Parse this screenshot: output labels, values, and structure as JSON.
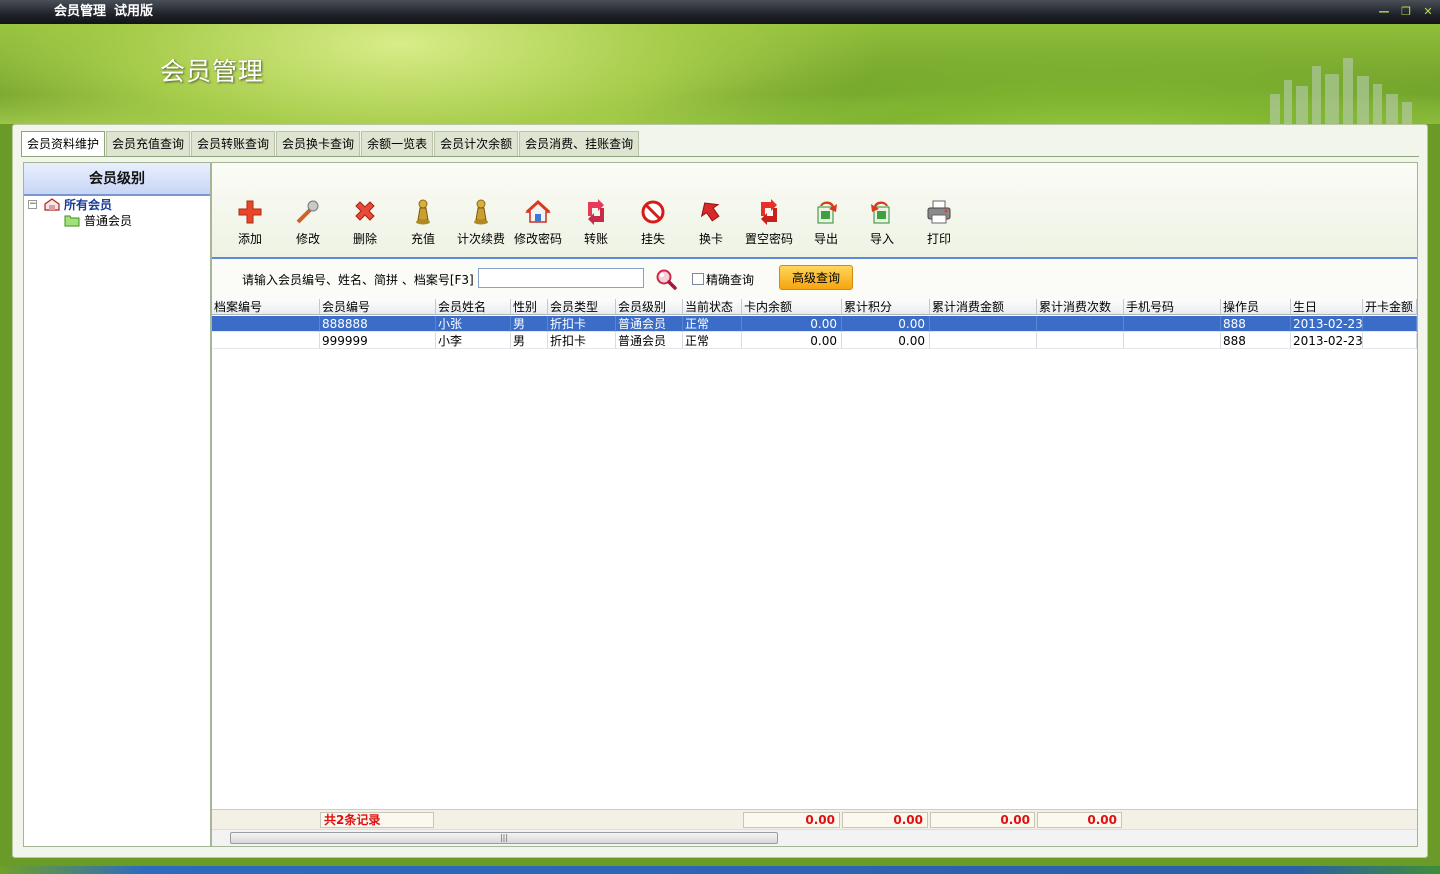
{
  "window": {
    "title": "会员管理",
    "edition": "试用版",
    "controls": [
      "—",
      "❐",
      "✕"
    ]
  },
  "banner": {
    "title": "会员管理"
  },
  "tabs": [
    {
      "label": "会员资料维护",
      "active": true
    },
    {
      "label": "会员充值查询"
    },
    {
      "label": "会员转账查询"
    },
    {
      "label": "会员换卡查询"
    },
    {
      "label": "余额一览表"
    },
    {
      "label": "会员计次余额"
    },
    {
      "label": "会员消费、挂账查询"
    }
  ],
  "sidebar": {
    "title": "会员级别",
    "tree": {
      "root": "所有会员",
      "expander": "−",
      "children": [
        "普通会员"
      ]
    }
  },
  "toolbar": {
    "buttons": [
      {
        "label": "添加",
        "icon": "add-icon"
      },
      {
        "label": "修改",
        "icon": "edit-icon"
      },
      {
        "label": "删除",
        "icon": "delete-icon"
      },
      {
        "label": "充值",
        "icon": "recharge-icon"
      },
      {
        "label": "计次续费",
        "icon": "count-renew-icon"
      },
      {
        "label": "修改密码",
        "icon": "change-password-icon"
      },
      {
        "label": "转账",
        "icon": "transfer-icon"
      },
      {
        "label": "挂失",
        "icon": "report-loss-icon"
      },
      {
        "label": "换卡",
        "icon": "replace-card-icon"
      },
      {
        "label": "置空密码",
        "icon": "clear-password-icon"
      },
      {
        "label": "导出",
        "icon": "export-icon"
      },
      {
        "label": "导入",
        "icon": "import-icon"
      },
      {
        "label": "打印",
        "icon": "print-icon"
      }
    ]
  },
  "search": {
    "label": "请输入会员编号、姓名、简拼 、档案号[F3]",
    "value": "",
    "exact_label": "精确查询",
    "exact_checked": false,
    "advanced_label": "高级查询"
  },
  "grid": {
    "columns": [
      "档案编号",
      "会员编号",
      "会员姓名",
      "性别",
      "会员类型",
      "会员级别",
      "当前状态",
      "卡内余额",
      "累计积分",
      "累计消费金额",
      "累计消费次数",
      "手机号码",
      "操作员",
      "生日",
      "开卡金额"
    ],
    "rows": [
      {
        "selected": true,
        "cells": [
          "",
          "888888",
          "小张",
          "男",
          "折扣卡",
          "普通会员",
          "正常",
          "0.00",
          "0.00",
          "",
          "",
          "",
          "888",
          "2013-02-23",
          ""
        ]
      },
      {
        "selected": false,
        "cells": [
          "",
          "999999",
          "小李",
          "男",
          "折扣卡",
          "普通会员",
          "正常",
          "0.00",
          "0.00",
          "",
          "",
          "",
          "888",
          "2013-02-23",
          ""
        ]
      }
    ],
    "footer": {
      "count_text": "共2条记录",
      "totals": [
        "0.00",
        "0.00",
        "0.00",
        "0.00"
      ]
    },
    "scroll_grip": "|||"
  },
  "colors": {
    "selection": "#3a6cc8",
    "accent": "#5c8ad8",
    "advanced_button": "#f5a410",
    "total_text": "#e01010"
  }
}
